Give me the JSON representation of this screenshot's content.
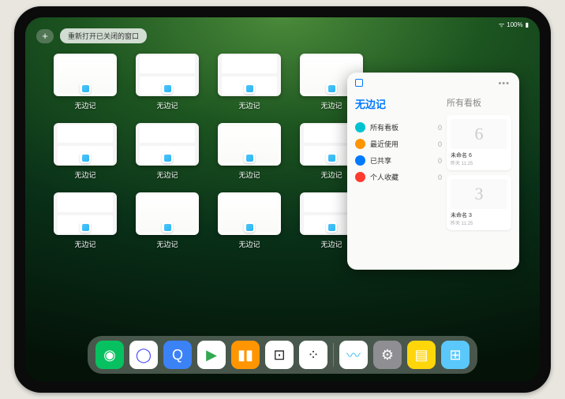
{
  "status": {
    "battery": "100%"
  },
  "topbar": {
    "plus": "+",
    "reopen": "重新打开已关闭的窗口"
  },
  "app_label": "无边记",
  "thumbs": [
    {
      "style": "single"
    },
    {
      "style": "double"
    },
    {
      "style": "double"
    },
    {
      "style": "single"
    },
    {
      "style": "double"
    },
    {
      "style": "double"
    },
    {
      "style": "single"
    },
    {
      "style": "double"
    },
    {
      "style": "double"
    },
    {
      "style": "single"
    },
    {
      "style": "single"
    },
    {
      "style": "double"
    }
  ],
  "panel": {
    "left_title": "无边记",
    "right_title": "所有看板",
    "items": [
      {
        "icon": "#00c2d1",
        "label": "所有看板",
        "count": "0"
      },
      {
        "icon": "#ff9500",
        "label": "最近使用",
        "count": "0"
      },
      {
        "icon": "#007aff",
        "label": "已共享",
        "count": "0"
      },
      {
        "icon": "#ff3b30",
        "label": "个人收藏",
        "count": "0"
      }
    ],
    "boards": [
      {
        "glyph": "6",
        "name": "未命名 6",
        "sub": "昨天 11:25"
      },
      {
        "glyph": "3",
        "name": "未命名 3",
        "sub": "昨天 11:25"
      }
    ]
  },
  "dock": [
    {
      "name": "wechat",
      "bg": "#07c160",
      "glyph": "◉"
    },
    {
      "name": "quark",
      "bg": "#ffffff",
      "glyph": "◯",
      "fg": "#4a4aff"
    },
    {
      "name": "qqbrowser",
      "bg": "#3b82f6",
      "glyph": "Q"
    },
    {
      "name": "media",
      "bg": "#ffffff",
      "glyph": "▶",
      "fg": "#33a852"
    },
    {
      "name": "books",
      "bg": "#ff9500",
      "glyph": "▮▮"
    },
    {
      "name": "app1",
      "bg": "#ffffff",
      "glyph": "⊡",
      "fg": "#222"
    },
    {
      "name": "app2",
      "bg": "#ffffff",
      "glyph": "⁘",
      "fg": "#222"
    },
    {
      "name": "freeform",
      "bg": "#ffffff",
      "glyph": "〰",
      "fg": "#4fc3f7"
    },
    {
      "name": "settings",
      "bg": "#8e8e93",
      "glyph": "⚙"
    },
    {
      "name": "notes",
      "bg": "#ffd60a",
      "glyph": "▤",
      "fg": "#fff"
    },
    {
      "name": "apps",
      "bg": "#5ac8fa",
      "glyph": "⊞"
    }
  ]
}
